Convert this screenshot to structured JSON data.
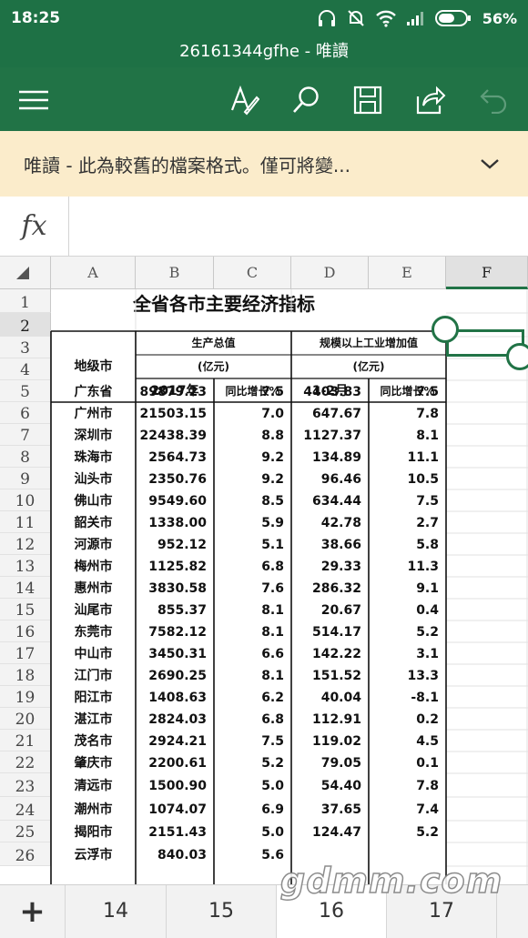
{
  "status_bar": {
    "time": "18:25",
    "battery": "56%"
  },
  "title_bar": {
    "title": "26161344gfhe - 唯讀"
  },
  "toolbar": {
    "icons": [
      "menu-icon",
      "draw-icon",
      "search-icon",
      "save-icon",
      "share-icon",
      "undo-icon"
    ]
  },
  "banner": {
    "text": "唯讀 - 此為較舊的檔案格式。僅可將變..."
  },
  "formula_bar": {
    "fx_label": "fx",
    "content": ""
  },
  "grid": {
    "columns": [
      "A",
      "B",
      "C",
      "D",
      "E",
      "F"
    ],
    "selected_column": "F",
    "selected_row": "2",
    "row_numbers": [
      "1",
      "2",
      "3",
      "4",
      "5",
      "6",
      "7",
      "8",
      "9",
      "10",
      "11",
      "12",
      "13",
      "14",
      "15",
      "16",
      "17",
      "18",
      "19",
      "20",
      "21",
      "22",
      "23",
      "24",
      "25",
      "26"
    ]
  },
  "sheet": {
    "title": "全省各市主要经济指标",
    "header_city": "地级市",
    "header_gdp": "生产总值",
    "header_gdp_unit": "(亿元)",
    "header_ind": "规模以上工业增加值",
    "header_ind_unit": "(亿元)",
    "sub_year": "2017年",
    "sub_growth1": "同比增长%",
    "sub_month": "1-2月",
    "sub_growth2": "同比增长%",
    "rows": [
      {
        "city": "广东省",
        "gdp": "89879.23",
        "gdp_g": "7.5",
        "ind": "4403.83",
        "ind_g": "7.5"
      },
      {
        "city": "广州市",
        "gdp": "21503.15",
        "gdp_g": "7.0",
        "ind": "647.67",
        "ind_g": "7.8"
      },
      {
        "city": "深圳市",
        "gdp": "22438.39",
        "gdp_g": "8.8",
        "ind": "1127.37",
        "ind_g": "8.1"
      },
      {
        "city": "珠海市",
        "gdp": "2564.73",
        "gdp_g": "9.2",
        "ind": "134.89",
        "ind_g": "11.1"
      },
      {
        "city": "汕头市",
        "gdp": "2350.76",
        "gdp_g": "9.2",
        "ind": "96.46",
        "ind_g": "10.5"
      },
      {
        "city": "佛山市",
        "gdp": "9549.60",
        "gdp_g": "8.5",
        "ind": "634.44",
        "ind_g": "7.5"
      },
      {
        "city": "韶关市",
        "gdp": "1338.00",
        "gdp_g": "5.9",
        "ind": "42.78",
        "ind_g": "2.7"
      },
      {
        "city": "河源市",
        "gdp": "952.12",
        "gdp_g": "5.1",
        "ind": "38.66",
        "ind_g": "5.8"
      },
      {
        "city": "梅州市",
        "gdp": "1125.82",
        "gdp_g": "6.8",
        "ind": "29.33",
        "ind_g": "11.3"
      },
      {
        "city": "惠州市",
        "gdp": "3830.58",
        "gdp_g": "7.6",
        "ind": "286.32",
        "ind_g": "9.1"
      },
      {
        "city": "汕尾市",
        "gdp": "855.37",
        "gdp_g": "8.1",
        "ind": "20.67",
        "ind_g": "0.4"
      },
      {
        "city": "东莞市",
        "gdp": "7582.12",
        "gdp_g": "8.1",
        "ind": "514.17",
        "ind_g": "5.2"
      },
      {
        "city": "中山市",
        "gdp": "3450.31",
        "gdp_g": "6.6",
        "ind": "142.22",
        "ind_g": "3.1"
      },
      {
        "city": "江门市",
        "gdp": "2690.25",
        "gdp_g": "8.1",
        "ind": "151.52",
        "ind_g": "13.3"
      },
      {
        "city": "阳江市",
        "gdp": "1408.63",
        "gdp_g": "6.2",
        "ind": "40.04",
        "ind_g": "-8.1"
      },
      {
        "city": "湛江市",
        "gdp": "2824.03",
        "gdp_g": "6.8",
        "ind": "112.91",
        "ind_g": "0.2"
      },
      {
        "city": "茂名市",
        "gdp": "2924.21",
        "gdp_g": "7.5",
        "ind": "119.02",
        "ind_g": "4.5"
      },
      {
        "city": "肇庆市",
        "gdp": "2200.61",
        "gdp_g": "5.2",
        "ind": "79.05",
        "ind_g": "0.1"
      },
      {
        "city": "清远市",
        "gdp": "1500.90",
        "gdp_g": "5.0",
        "ind": "54.40",
        "ind_g": "7.8"
      },
      {
        "city": "潮州市",
        "gdp": "1074.07",
        "gdp_g": "6.9",
        "ind": "37.65",
        "ind_g": "7.4"
      },
      {
        "city": "揭阳市",
        "gdp": "2151.43",
        "gdp_g": "5.0",
        "ind": "124.47",
        "ind_g": "5.2"
      },
      {
        "city": "云浮市",
        "gdp": "840.03",
        "gdp_g": "5.6",
        "ind": "",
        "ind_g": ""
      }
    ]
  },
  "tabs": {
    "add_label": "+",
    "items": [
      "14",
      "15",
      "16",
      "17"
    ],
    "active": "16"
  },
  "watermark": "gdmm.com",
  "colors": {
    "header_green": "#217346",
    "banner_bg": "#fbeccb",
    "selection": "#217346"
  }
}
